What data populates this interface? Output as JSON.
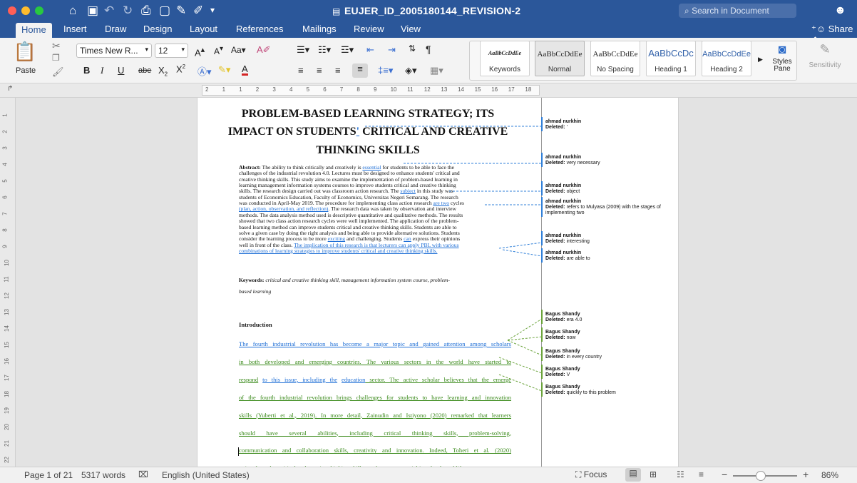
{
  "window": {
    "doc_title": "EUJER_ID_2005180144_REVISION-2",
    "search_placeholder": "Search in Document"
  },
  "tabs": [
    "Home",
    "Insert",
    "Draw",
    "Design",
    "Layout",
    "References",
    "Mailings",
    "Review",
    "View"
  ],
  "share_label": "Share",
  "ribbon": {
    "paste_label": "Paste",
    "font_name": "Times New R...",
    "font_size": "12",
    "styles": [
      {
        "preview": "AaBbCcDdEe",
        "label": "Keywords"
      },
      {
        "preview": "AaBbCcDdEe",
        "label": "Normal"
      },
      {
        "preview": "AaBbCcDdEe",
        "label": "No Spacing"
      },
      {
        "preview": "AaBbCcDc",
        "label": "Heading 1"
      },
      {
        "preview": "AaBbCcDdEe",
        "label": "Heading 2"
      }
    ],
    "styles_pane_label": "Styles Pane",
    "sensitivity_label": "Sensitivity"
  },
  "ruler": {
    "marks": [
      "2",
      "1",
      "1",
      "2",
      "3",
      "4",
      "5",
      "6",
      "7",
      "8",
      "9",
      "10",
      "11",
      "12",
      "13",
      "14",
      "15",
      "16",
      "17",
      "18"
    ]
  },
  "vertical_ruler": [
    "1",
    "2",
    "3",
    "4",
    "5",
    "6",
    "7",
    "8",
    "9",
    "10",
    "11",
    "12",
    "13",
    "14",
    "15",
    "16",
    "17",
    "18",
    "19",
    "20",
    "21",
    "22"
  ],
  "document": {
    "title_lines": [
      "PROBLEM-BASED LEARNING STRATEGY; ITS",
      "IMPACT ON STUDENTS' CRITICAL AND CREATIVE",
      "THINKING SKILLS"
    ],
    "abstract_lines": [
      "Abstract: The ability to think critically and creatively is essential for students to be able to face the",
      "challenges of the industrial revolution 4.0. Lectures must be designed to enhance students' critical and",
      "creative thinking skills. This study aims to examine the implementation of problem-based learning in",
      "learning management information systems courses to improve students critical and creative thinking",
      "skills. The research design carried out was classroom action research. The subject in this study was",
      "students of Economics Education, Faculty of Economics, Universitas Negeri Semarang. The research",
      "was conducted in April-May 2019. The procedure for implementing class action research are two cycles",
      "(plan, action, observation, and reflection). The research data was taken by observation and interview",
      "methods. The data analysis method used is descriptive quantitative and qualitative methods. The results",
      "showed that two class action research cycles were well implemented. The application of the problem-",
      "based learning method can improve students critical and creative thinking skills. Students are able to",
      "solve a given case by doing the right analysis and being able to provide alternative solutions. Students",
      "consider the learning process to be more exciting and challenging. Students can express their opinions",
      "well in front of the class. The implication of this research is that lecturers can apply PBL with various",
      "combinations of learning strategies to improve students' critical and creative thinking skills."
    ],
    "keywords_lines": [
      "Keywords: critical and creative thinking skill, management information system course, problem-",
      "based learning"
    ],
    "intro_heading": "Introduction",
    "intro_lines": [
      "The fourth industrial revolution has become a major topic and gained attention among scholars",
      "in both developed and emerging countries. The various sectors in the world have started to",
      "respond to this issue, including the education sector. The active scholar believes that the emerge",
      "of the fourth industrial revolution brings challenges for students to have learning and innovation",
      "skills (Yuberti et al., 2019). In more detail, Zainudin and Istiyono (2020) remarked that learners",
      "should have several abilities, including critical thinking skills, problem-solving,",
      "communication and collaboration skills, creativity and innovation. Indeed, Toheri et al. (2020)",
      "pointed out that critical and creative thinking skills are the most essential in schools and life"
    ]
  },
  "comments": [
    {
      "author": "ahmad nurkhin",
      "text": "Deleted: '"
    },
    {
      "author": "ahmad nurkhin",
      "text": "Deleted: very necessary"
    },
    {
      "author": "ahmad nurkhin",
      "text": "Deleted: object"
    },
    {
      "author": "ahmad nurkhin",
      "text": "Deleted: refers to Mulyasa (2009) with the stages of implementing two"
    },
    {
      "author": "ahmad nurkhin",
      "text": "Deleted: interesting"
    },
    {
      "author": "ahmad nurkhin",
      "text": "Deleted: are able to"
    },
    {
      "author": "Bagus Shandy",
      "text": "Deleted: era 4.0"
    },
    {
      "author": "Bagus Shandy",
      "text": "Deleted: now"
    },
    {
      "author": "Bagus Shandy",
      "text": "Deleted: in every country"
    },
    {
      "author": "Bagus Shandy",
      "text": "Deleted: V"
    },
    {
      "author": "Bagus Shandy",
      "text": "Deleted: quickly to this problem"
    }
  ],
  "status": {
    "page": "Page 1 of 21",
    "words": "5317 words",
    "language": "English (United States)",
    "focus": "Focus",
    "zoom": "86%",
    "zoom_level": 0.86
  },
  "colors": {
    "titlebar": "#2b579a",
    "insert_blue": "#1f6fd6",
    "insert_green": "#3a8a1a",
    "comment_blue": "#2f7fd8",
    "comment_green": "#6aa33a"
  }
}
